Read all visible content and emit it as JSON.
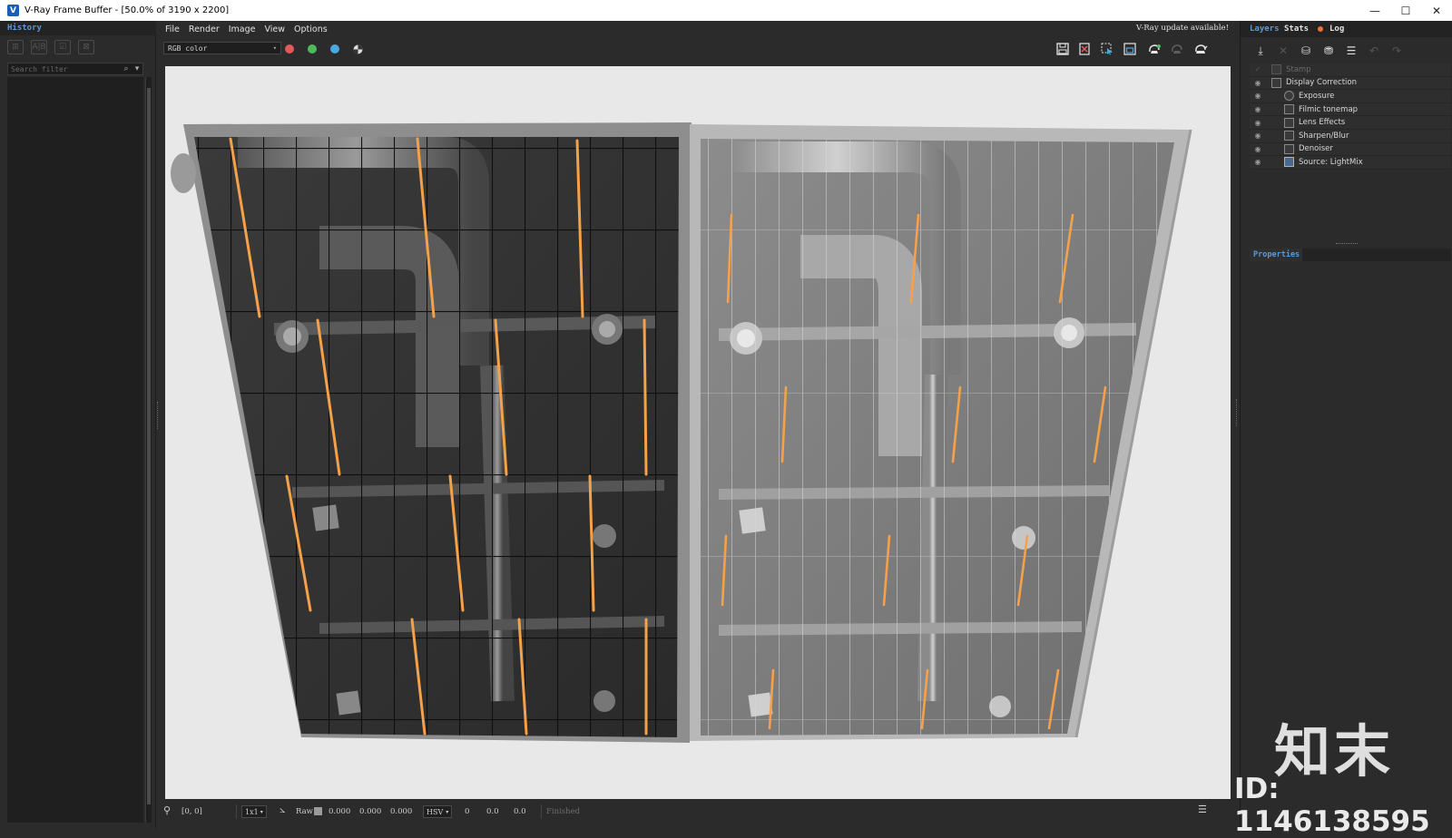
{
  "window": {
    "title": "V-Ray Frame Buffer - [50.0% of 3190 x 2200]",
    "minimize": "—",
    "maximize": "☐",
    "close": "✕"
  },
  "history": {
    "tab": "History",
    "search_placeholder": "Search filter",
    "tools": [
      "save-history-icon",
      "compare-ab-icon",
      "load-history-icon",
      "remove-history-icon"
    ]
  },
  "menu": {
    "items": [
      "File",
      "Render",
      "Image",
      "View",
      "Options"
    ],
    "update_notice": "V-Ray update available!"
  },
  "toolbar": {
    "channel": "RGB color",
    "channel_colors": {
      "red": "#e05a5a",
      "green": "#4cbb5a",
      "blue": "#4aa8e0"
    }
  },
  "layers_panel": {
    "tabs": [
      "Layers",
      "Stats",
      "Log"
    ],
    "layers": [
      {
        "name": "Stamp",
        "visible": false,
        "indent": 0
      },
      {
        "name": "Display Correction",
        "visible": true,
        "indent": 0
      },
      {
        "name": "Exposure",
        "visible": true,
        "indent": 1
      },
      {
        "name": "Filmic tonemap",
        "visible": true,
        "indent": 1
      },
      {
        "name": "Lens Effects",
        "visible": true,
        "indent": 1
      },
      {
        "name": "Sharpen/Blur",
        "visible": true,
        "indent": 1
      },
      {
        "name": "Denoiser",
        "visible": true,
        "indent": 1
      },
      {
        "name": "Source: LightMix",
        "visible": true,
        "indent": 1
      }
    ],
    "properties_tab": "Properties"
  },
  "statusbar": {
    "coords": "[0, 0]",
    "zoom": "1x1",
    "raw": "Raw",
    "v1": "0.000",
    "v2": "0.000",
    "v3": "0.000",
    "mode": "HSV",
    "h": "0",
    "s": "0.0",
    "v": "0.0",
    "status": "Finished"
  },
  "watermark": {
    "logo": "知末",
    "id": "ID: 1146138595"
  }
}
